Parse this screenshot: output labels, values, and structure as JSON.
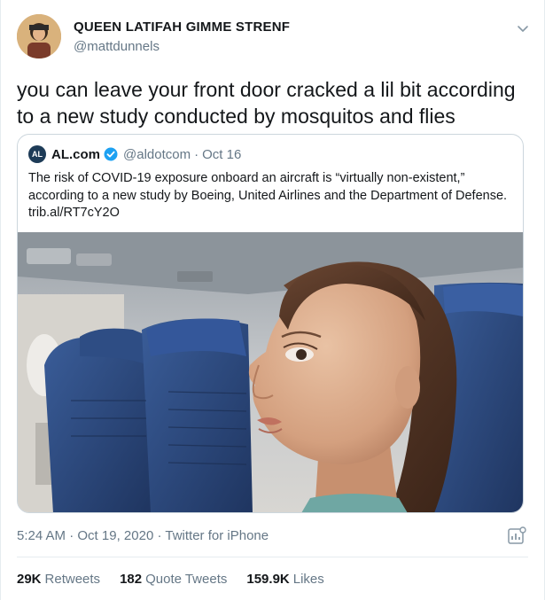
{
  "author": {
    "name": "QUEEN LATIFAH GIMME STRENF",
    "handle": "@mattdunnels",
    "avatar_icon": "avatar-illustration"
  },
  "tweet": {
    "text": "you can leave your front door cracked a lil bit according to a new study conducted by mosquitos and flies"
  },
  "quote": {
    "logo_text": "AL",
    "name": "AL.com",
    "verified": true,
    "handle": "@aldotcom",
    "separator": "·",
    "date": "Oct 16",
    "text": "The risk of COVID-19 exposure onboard an aircraft is “virtually non-existent,” according to a new study by Boeing, United Airlines and the Department of Defense. trib.al/RT7cY2O",
    "media_icon": "mannequin-on-airplane-photo"
  },
  "meta": {
    "time": "5:24 AM",
    "date": "Oct 19, 2020",
    "source": "Twitter for iPhone",
    "separator": "·"
  },
  "stats": {
    "retweets_count": "29K",
    "retweets_label": "Retweets",
    "quotes_count": "182",
    "quotes_label": "Quote Tweets",
    "likes_count": "159.9K",
    "likes_label": "Likes"
  },
  "colors": {
    "text": "#14171a",
    "secondary": "#657786",
    "border": "#ccd6dd",
    "verified": "#1da1f2",
    "seat_blue": "#2f4f86"
  }
}
